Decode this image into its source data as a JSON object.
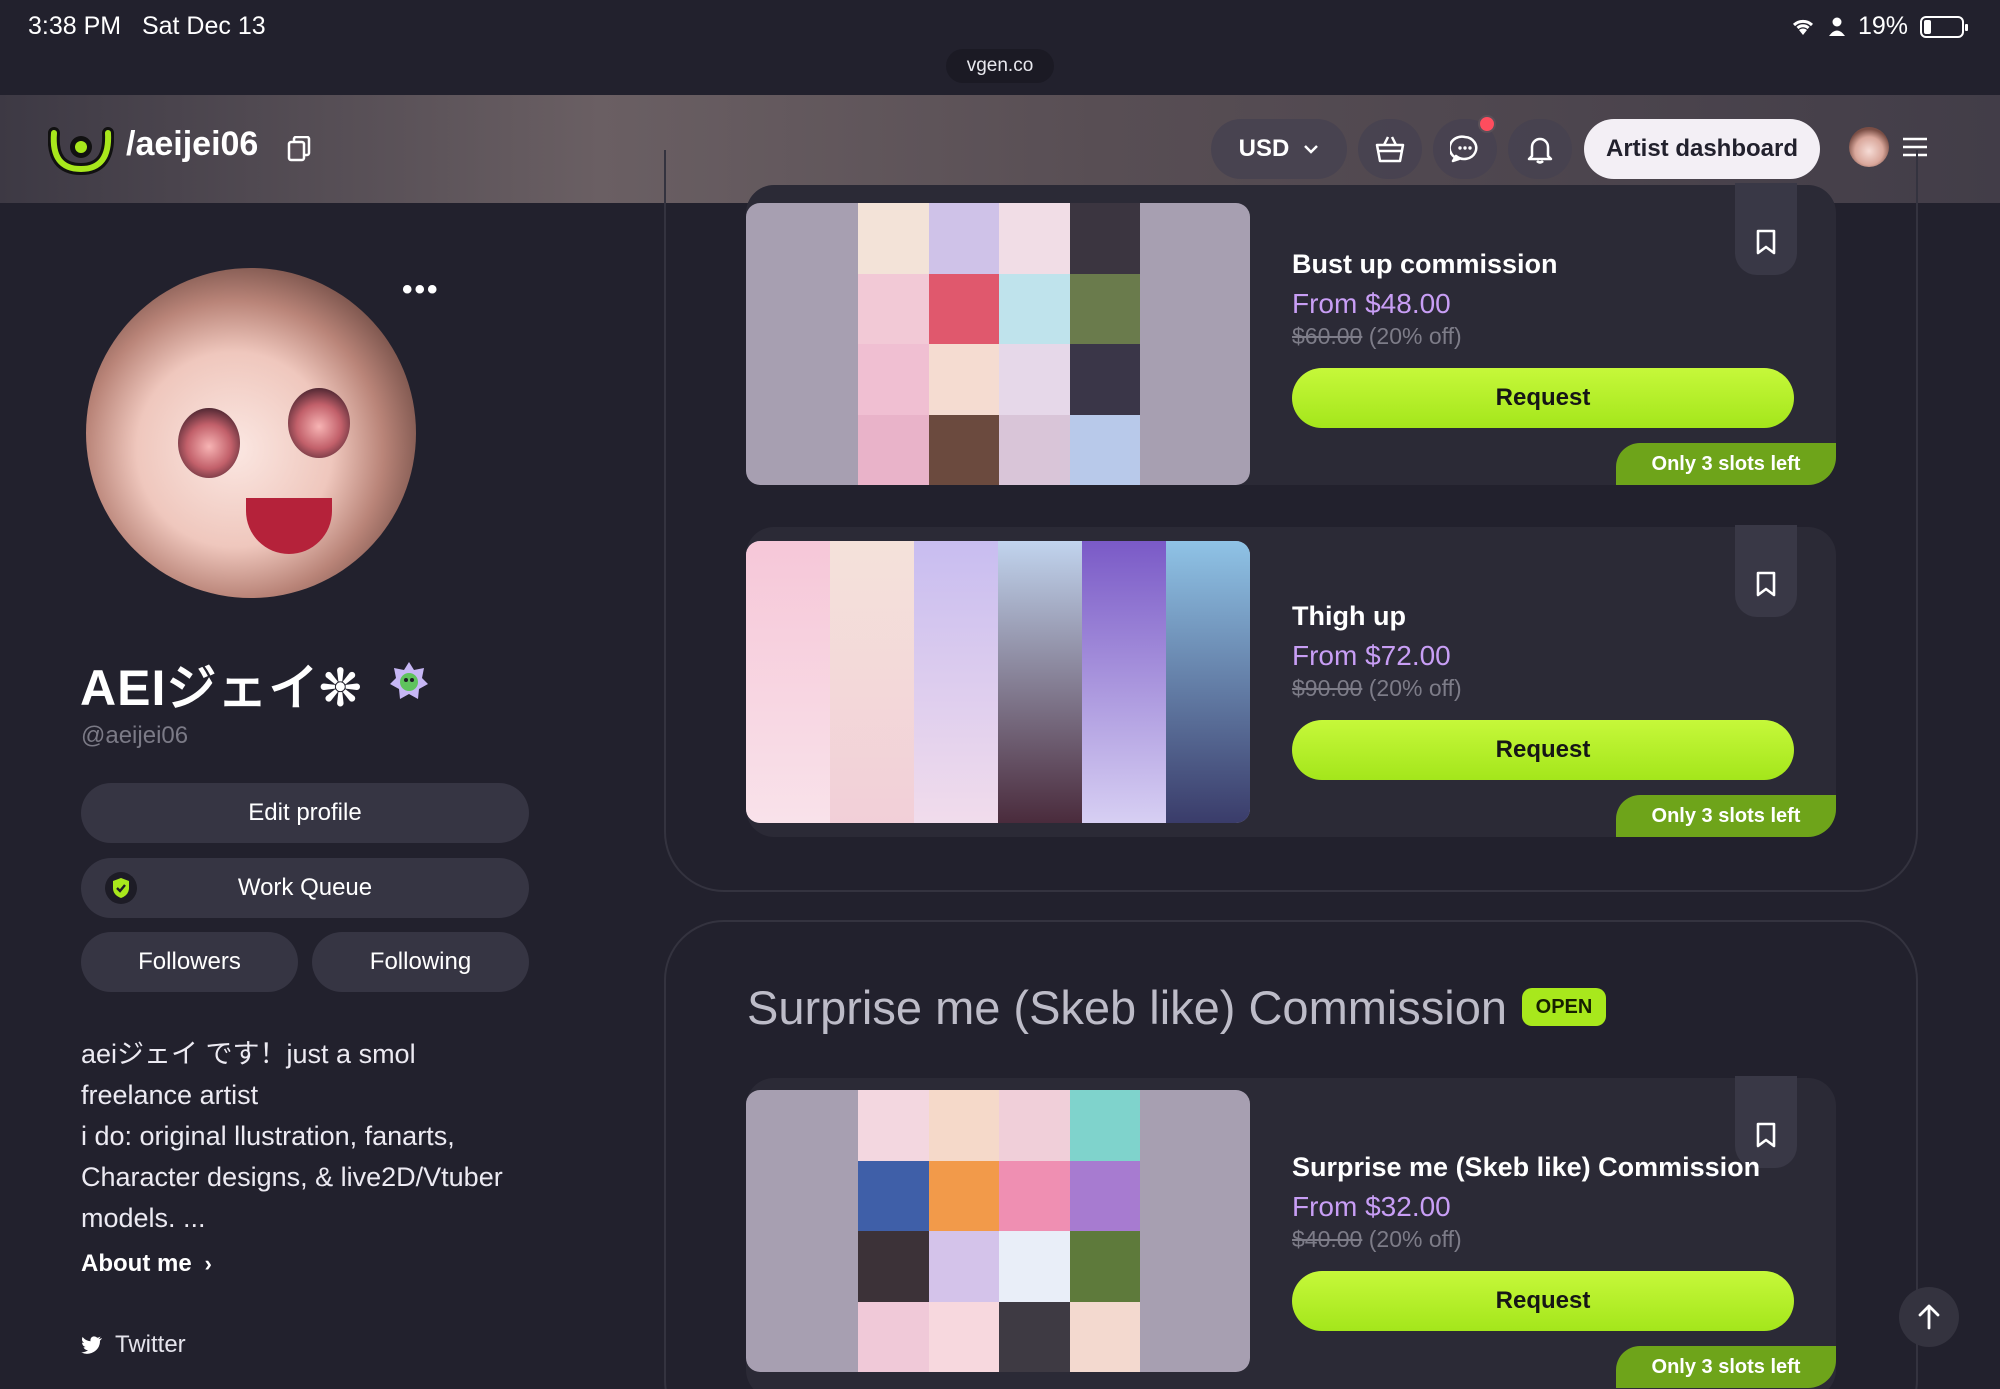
{
  "status_bar": {
    "time": "3:38 PM",
    "date": "Sat Dec 13",
    "battery": "19%"
  },
  "browser": {
    "url": "vgen.co"
  },
  "header": {
    "handle": "/aeijei06",
    "currency": "USD",
    "artist_dashboard": "Artist dashboard"
  },
  "profile": {
    "display_name": "AEIジェイ❊",
    "username": "@aeijei06",
    "more": "•••",
    "edit_profile": "Edit profile",
    "work_queue": "Work Queue",
    "followers": "Followers",
    "following": "Following",
    "bio_lines": [
      "aeiジェイ です！just a smol",
      "freelance artist",
      "i do: original llustration, fanarts,",
      "Character designs, & live2D/Vtuber",
      "models. ..."
    ],
    "about_me": "About me",
    "twitter": "Twitter"
  },
  "services": [
    {
      "title": "Bust up commission",
      "price": "From $48.00",
      "old_price": "$60.00",
      "discount": "(20% off)",
      "request": "Request",
      "slots": "Only 3 slots left"
    },
    {
      "title": "Thigh up",
      "price": "From $72.00",
      "old_price": "$90.00",
      "discount": "(20% off)",
      "request": "Request",
      "slots": "Only 3 slots left"
    }
  ],
  "section2": {
    "heading": "Surprise me (Skeb like) Commission",
    "status": "OPEN",
    "card": {
      "title": "Surprise me (Skeb like) Commission",
      "price": "From $32.00",
      "old_price": "$40.00",
      "discount": "(20% off)",
      "request": "Request",
      "slots": "Only 3 slots left"
    }
  },
  "colors": {
    "accent": "#a8e81c",
    "price": "#c89ef5",
    "background": "#22212d",
    "slots": "#6ea41a",
    "notification": "#ff4d5e"
  }
}
